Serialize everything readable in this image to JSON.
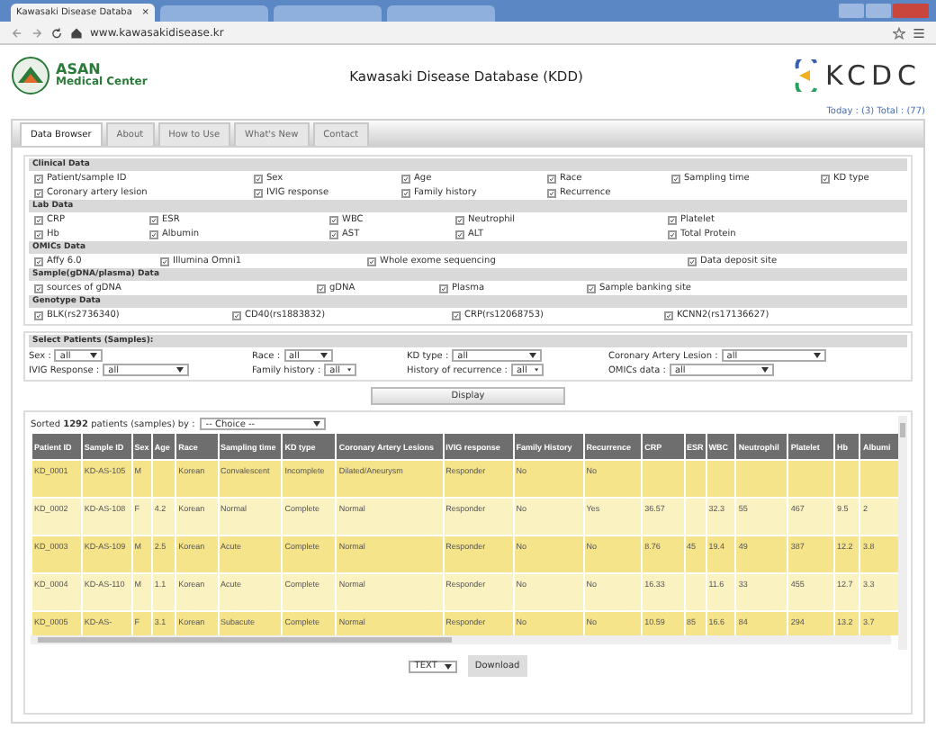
{
  "browser": {
    "tabs": [
      {
        "title": "Kawasaki Disease Databa",
        "close": "×",
        "selected": true
      },
      {
        "selected": false
      },
      {
        "selected": false
      },
      {
        "selected": false
      }
    ],
    "address": "www.kawasakidisease.kr"
  },
  "header": {
    "logo_line1": "ASAN",
    "logo_line2": "Medical Center",
    "title": "Kawasaki Disease Database (KDD)",
    "partner": "KCDC",
    "counter": "Today : (3) Total : (77)"
  },
  "tabs": [
    {
      "label": "Data Browser",
      "selected": true
    },
    {
      "label": "About",
      "selected": false
    },
    {
      "label": "How to Use",
      "selected": false
    },
    {
      "label": "What's New",
      "selected": false
    },
    {
      "label": "Contact",
      "selected": false
    }
  ],
  "sections": [
    {
      "title": "Clinical Data",
      "items": [
        {
          "label": "Patient/sample ID",
          "checked": true
        },
        {
          "label": "Sex",
          "checked": true
        },
        {
          "label": "Age",
          "checked": true
        },
        {
          "label": "Race",
          "checked": true
        },
        {
          "label": "Sampling time",
          "checked": true
        },
        {
          "label": "KD type",
          "checked": true
        },
        {
          "label": "Coronary artery lesion",
          "checked": true
        },
        {
          "label": "IVIG response",
          "checked": true
        },
        {
          "label": "Family history",
          "checked": true
        },
        {
          "label": "Recurrence",
          "checked": true
        }
      ]
    },
    {
      "title": "Lab Data",
      "items": [
        {
          "label": "CRP",
          "checked": true
        },
        {
          "label": "ESR",
          "checked": true
        },
        {
          "label": "WBC",
          "checked": true
        },
        {
          "label": "Neutrophil",
          "checked": true
        },
        {
          "label": "Platelet",
          "checked": true
        },
        {
          "label": "Hb",
          "checked": true
        },
        {
          "label": "Albumin",
          "checked": true
        },
        {
          "label": "AST",
          "checked": true
        },
        {
          "label": "ALT",
          "checked": true
        },
        {
          "label": "Total Protein",
          "checked": true
        }
      ]
    },
    {
      "title": "OMICs Data",
      "items": [
        {
          "label": "Affy 6.0",
          "checked": true
        },
        {
          "label": "Illumina Omni1",
          "checked": true
        },
        {
          "label": "Whole exome sequencing",
          "checked": true
        },
        {
          "label": "Data deposit site",
          "checked": true
        }
      ]
    },
    {
      "title": "Sample(gDNA/plasma) Data",
      "items": [
        {
          "label": "sources of gDNA",
          "checked": true
        },
        {
          "label": "gDNA",
          "checked": true
        },
        {
          "label": "Plasma",
          "checked": true
        },
        {
          "label": "Sample banking site",
          "checked": true
        }
      ]
    },
    {
      "title": "Genotype Data",
      "items": [
        {
          "label": "BLK(rs2736340)",
          "checked": true
        },
        {
          "label": "CD40(rs1883832)",
          "checked": true
        },
        {
          "label": "CRP(rs12068753)",
          "checked": true
        },
        {
          "label": "KCNN2(rs17136627)",
          "checked": true
        }
      ]
    }
  ],
  "select_patients": {
    "title": "Select Patients (Samples):",
    "filters": [
      {
        "label": "Sex :",
        "value": "all"
      },
      {
        "label": "Race :",
        "value": "all"
      },
      {
        "label": "KD type :",
        "value": "all"
      },
      {
        "label": "Coronary Artery Lesion :",
        "value": "all"
      },
      {
        "label": "IVIG Response :",
        "value": "all"
      },
      {
        "label": "Family history :",
        "value": "all"
      },
      {
        "label": "History of recurrence :",
        "value": "all"
      },
      {
        "label": "OMICs data :",
        "value": "all"
      }
    ]
  },
  "display_button": "Display",
  "sort": {
    "text": "Sorted **1292** patients (samples) by :",
    "value": "-- Choice --"
  },
  "table": {
    "columns": [
      "Patient ID",
      "Sample ID",
      "Sex",
      "Age",
      "Race",
      "Sampling time",
      "KD type",
      "Coronary Artery Lesions",
      "IVIG response",
      "Family History",
      "Recurrence",
      "CRP",
      "ESR",
      "WBC",
      "Neutrophil",
      "Platelet",
      "Hb",
      "Albumi"
    ],
    "rows": [
      [
        "KD_0001",
        "KD-AS-105",
        "M",
        null,
        "Korean",
        "Convalescent",
        "Incomplete",
        "Dilated/Aneurysm",
        "Responder",
        "No",
        "No",
        null,
        null,
        null,
        null,
        null,
        null,
        null
      ],
      [
        "KD_0002",
        "KD-AS-108",
        "F",
        "4.2",
        "Korean",
        "Normal",
        "Complete",
        "Normal",
        "Responder",
        "No",
        "Yes",
        "36.57",
        null,
        "32.3",
        "55",
        "467",
        "9.5",
        "2"
      ],
      [
        "KD_0003",
        "KD-AS-109",
        "M",
        "2.5",
        "Korean",
        "Acute",
        "Complete",
        "Normal",
        "Responder",
        "No",
        "No",
        "8.76",
        "45",
        "19.4",
        "49",
        "387",
        "12.2",
        "3.8"
      ],
      [
        "KD_0004",
        "KD-AS-110",
        "M",
        "1.1",
        "Korean",
        "Acute",
        "Complete",
        "Normal",
        "Responder",
        "No",
        "No",
        "16.33",
        null,
        "11.6",
        "33",
        "455",
        "12.7",
        "3.3"
      ],
      [
        "KD_0005",
        "KD-AS-",
        "F",
        "3.1",
        "Korean",
        "Subacute",
        "Complete",
        "Normal",
        "Responder",
        "No",
        "No",
        "10.59",
        "85",
        "16.6",
        "84",
        "294",
        "13.2",
        "3.7"
      ]
    ]
  },
  "export": {
    "format": "TEXT",
    "button": "Download"
  }
}
